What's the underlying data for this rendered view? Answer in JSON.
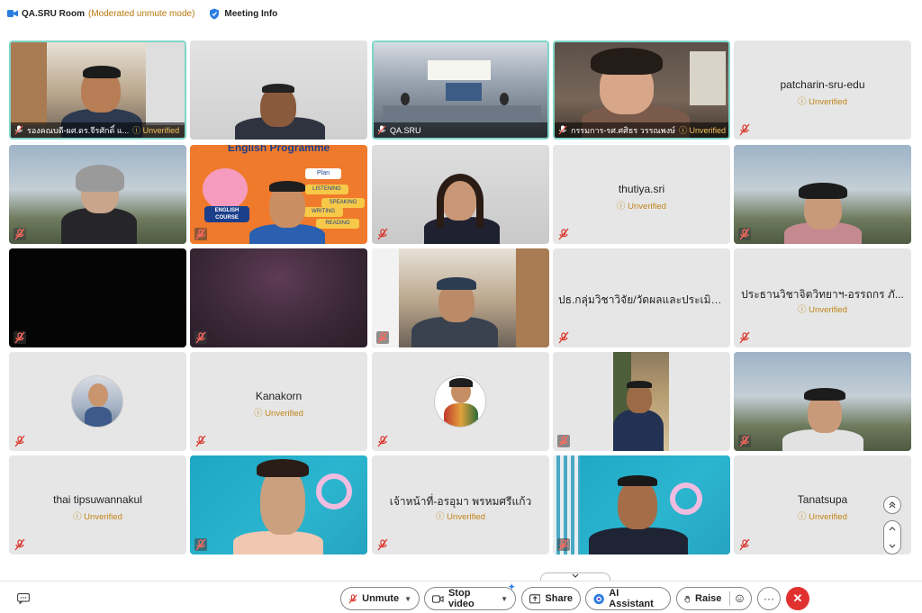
{
  "topbar": {
    "room_name": "QA.SRU Room",
    "mode": "(Moderated unmute mode)",
    "meeting_info": "Meeting Info"
  },
  "unverified": "Unverified",
  "participants": [
    {
      "label": "รองคณบดี-ผศ.ดร.จีรศักดิ์ แ...",
      "unverified": "Unverified"
    },
    {
      "label": ""
    },
    {
      "label": "QA.SRU"
    },
    {
      "label": "กรรมการ-รศ.ศศิธร วรรณพงษ์",
      "unverified": "Unverified"
    },
    {
      "name": "patcharin-sru-edu",
      "unverified": "Unverified"
    },
    {
      "label": ""
    },
    {
      "banner": "English Programme",
      "course": "ENGLISH COURSE",
      "chips": [
        "Plan",
        "LISTENING",
        "SPEAKING",
        "WRITING",
        "READING"
      ]
    },
    {
      "label": ""
    },
    {
      "name": "thutiya.sri",
      "unverified": "Unverified"
    },
    {
      "label": ""
    },
    {
      "label": ""
    },
    {
      "label": ""
    },
    {
      "label": ""
    },
    {
      "name": "ปธ.กลุ่มวิชาวิจัย/วัดผลและประเมิน..."
    },
    {
      "name": "ประธานวิชาจิตวิทยาฯ-อรรถกร ภั...",
      "unverified": "Unverified"
    },
    {
      "label": ""
    },
    {
      "name": "Kanakorn",
      "unverified": "Unverified"
    },
    {
      "label": ""
    },
    {
      "label": ""
    },
    {
      "label": ""
    },
    {
      "name": "thai tipsuwannakul",
      "unverified": "Unverified"
    },
    {
      "label": ""
    },
    {
      "name": "เจ้าหน้าที่-อรอุมา พรหมศรีแก้ว",
      "unverified": "Unverified"
    },
    {
      "label": ""
    },
    {
      "name": "Tanatsupa",
      "unverified": "Unverified"
    }
  ],
  "toolbar": {
    "unmute": "Unmute",
    "stop_video": "Stop video",
    "share": "Share",
    "ai_assistant": "AI Assistant",
    "raise": "Raise",
    "more": "···"
  },
  "colors": {
    "accent": "#7fd6c9",
    "unverified": "#c0841a",
    "end_call": "#e0312f",
    "mute_red": "#d9352b"
  }
}
